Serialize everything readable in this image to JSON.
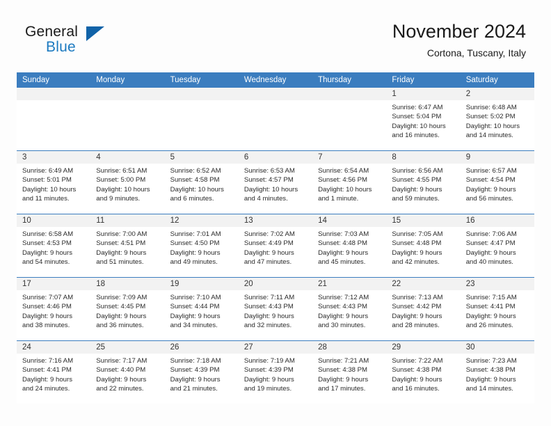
{
  "brand": {
    "name_part1": "General",
    "name_part2": "Blue",
    "logo_icon": "triangle-logo-icon"
  },
  "header": {
    "title": "November 2024",
    "location": "Cortona, Tuscany, Italy"
  },
  "colors": {
    "header_blue": "#3B7DBF",
    "brand_blue": "#1c7ac0",
    "logo_blue": "#1163a8",
    "daynum_band": "#f2f2f2",
    "page_bg": "#fdfdfd"
  },
  "weekdays": [
    "Sunday",
    "Monday",
    "Tuesday",
    "Wednesday",
    "Thursday",
    "Friday",
    "Saturday"
  ],
  "weeks": [
    [
      {
        "empty": true
      },
      {
        "empty": true
      },
      {
        "empty": true
      },
      {
        "empty": true
      },
      {
        "empty": true
      },
      {
        "day": "1",
        "sunrise": "Sunrise: 6:47 AM",
        "sunset": "Sunset: 5:04 PM",
        "daylight_line1": "Daylight: 10 hours",
        "daylight_line2": "and 16 minutes."
      },
      {
        "day": "2",
        "sunrise": "Sunrise: 6:48 AM",
        "sunset": "Sunset: 5:02 PM",
        "daylight_line1": "Daylight: 10 hours",
        "daylight_line2": "and 14 minutes."
      }
    ],
    [
      {
        "day": "3",
        "sunrise": "Sunrise: 6:49 AM",
        "sunset": "Sunset: 5:01 PM",
        "daylight_line1": "Daylight: 10 hours",
        "daylight_line2": "and 11 minutes."
      },
      {
        "day": "4",
        "sunrise": "Sunrise: 6:51 AM",
        "sunset": "Sunset: 5:00 PM",
        "daylight_line1": "Daylight: 10 hours",
        "daylight_line2": "and 9 minutes."
      },
      {
        "day": "5",
        "sunrise": "Sunrise: 6:52 AM",
        "sunset": "Sunset: 4:58 PM",
        "daylight_line1": "Daylight: 10 hours",
        "daylight_line2": "and 6 minutes."
      },
      {
        "day": "6",
        "sunrise": "Sunrise: 6:53 AM",
        "sunset": "Sunset: 4:57 PM",
        "daylight_line1": "Daylight: 10 hours",
        "daylight_line2": "and 4 minutes."
      },
      {
        "day": "7",
        "sunrise": "Sunrise: 6:54 AM",
        "sunset": "Sunset: 4:56 PM",
        "daylight_line1": "Daylight: 10 hours",
        "daylight_line2": "and 1 minute."
      },
      {
        "day": "8",
        "sunrise": "Sunrise: 6:56 AM",
        "sunset": "Sunset: 4:55 PM",
        "daylight_line1": "Daylight: 9 hours",
        "daylight_line2": "and 59 minutes."
      },
      {
        "day": "9",
        "sunrise": "Sunrise: 6:57 AM",
        "sunset": "Sunset: 4:54 PM",
        "daylight_line1": "Daylight: 9 hours",
        "daylight_line2": "and 56 minutes."
      }
    ],
    [
      {
        "day": "10",
        "sunrise": "Sunrise: 6:58 AM",
        "sunset": "Sunset: 4:53 PM",
        "daylight_line1": "Daylight: 9 hours",
        "daylight_line2": "and 54 minutes."
      },
      {
        "day": "11",
        "sunrise": "Sunrise: 7:00 AM",
        "sunset": "Sunset: 4:51 PM",
        "daylight_line1": "Daylight: 9 hours",
        "daylight_line2": "and 51 minutes."
      },
      {
        "day": "12",
        "sunrise": "Sunrise: 7:01 AM",
        "sunset": "Sunset: 4:50 PM",
        "daylight_line1": "Daylight: 9 hours",
        "daylight_line2": "and 49 minutes."
      },
      {
        "day": "13",
        "sunrise": "Sunrise: 7:02 AM",
        "sunset": "Sunset: 4:49 PM",
        "daylight_line1": "Daylight: 9 hours",
        "daylight_line2": "and 47 minutes."
      },
      {
        "day": "14",
        "sunrise": "Sunrise: 7:03 AM",
        "sunset": "Sunset: 4:48 PM",
        "daylight_line1": "Daylight: 9 hours",
        "daylight_line2": "and 45 minutes."
      },
      {
        "day": "15",
        "sunrise": "Sunrise: 7:05 AM",
        "sunset": "Sunset: 4:48 PM",
        "daylight_line1": "Daylight: 9 hours",
        "daylight_line2": "and 42 minutes."
      },
      {
        "day": "16",
        "sunrise": "Sunrise: 7:06 AM",
        "sunset": "Sunset: 4:47 PM",
        "daylight_line1": "Daylight: 9 hours",
        "daylight_line2": "and 40 minutes."
      }
    ],
    [
      {
        "day": "17",
        "sunrise": "Sunrise: 7:07 AM",
        "sunset": "Sunset: 4:46 PM",
        "daylight_line1": "Daylight: 9 hours",
        "daylight_line2": "and 38 minutes."
      },
      {
        "day": "18",
        "sunrise": "Sunrise: 7:09 AM",
        "sunset": "Sunset: 4:45 PM",
        "daylight_line1": "Daylight: 9 hours",
        "daylight_line2": "and 36 minutes."
      },
      {
        "day": "19",
        "sunrise": "Sunrise: 7:10 AM",
        "sunset": "Sunset: 4:44 PM",
        "daylight_line1": "Daylight: 9 hours",
        "daylight_line2": "and 34 minutes."
      },
      {
        "day": "20",
        "sunrise": "Sunrise: 7:11 AM",
        "sunset": "Sunset: 4:43 PM",
        "daylight_line1": "Daylight: 9 hours",
        "daylight_line2": "and 32 minutes."
      },
      {
        "day": "21",
        "sunrise": "Sunrise: 7:12 AM",
        "sunset": "Sunset: 4:43 PM",
        "daylight_line1": "Daylight: 9 hours",
        "daylight_line2": "and 30 minutes."
      },
      {
        "day": "22",
        "sunrise": "Sunrise: 7:13 AM",
        "sunset": "Sunset: 4:42 PM",
        "daylight_line1": "Daylight: 9 hours",
        "daylight_line2": "and 28 minutes."
      },
      {
        "day": "23",
        "sunrise": "Sunrise: 7:15 AM",
        "sunset": "Sunset: 4:41 PM",
        "daylight_line1": "Daylight: 9 hours",
        "daylight_line2": "and 26 minutes."
      }
    ],
    [
      {
        "day": "24",
        "sunrise": "Sunrise: 7:16 AM",
        "sunset": "Sunset: 4:41 PM",
        "daylight_line1": "Daylight: 9 hours",
        "daylight_line2": "and 24 minutes."
      },
      {
        "day": "25",
        "sunrise": "Sunrise: 7:17 AM",
        "sunset": "Sunset: 4:40 PM",
        "daylight_line1": "Daylight: 9 hours",
        "daylight_line2": "and 22 minutes."
      },
      {
        "day": "26",
        "sunrise": "Sunrise: 7:18 AM",
        "sunset": "Sunset: 4:39 PM",
        "daylight_line1": "Daylight: 9 hours",
        "daylight_line2": "and 21 minutes."
      },
      {
        "day": "27",
        "sunrise": "Sunrise: 7:19 AM",
        "sunset": "Sunset: 4:39 PM",
        "daylight_line1": "Daylight: 9 hours",
        "daylight_line2": "and 19 minutes."
      },
      {
        "day": "28",
        "sunrise": "Sunrise: 7:21 AM",
        "sunset": "Sunset: 4:38 PM",
        "daylight_line1": "Daylight: 9 hours",
        "daylight_line2": "and 17 minutes."
      },
      {
        "day": "29",
        "sunrise": "Sunrise: 7:22 AM",
        "sunset": "Sunset: 4:38 PM",
        "daylight_line1": "Daylight: 9 hours",
        "daylight_line2": "and 16 minutes."
      },
      {
        "day": "30",
        "sunrise": "Sunrise: 7:23 AM",
        "sunset": "Sunset: 4:38 PM",
        "daylight_line1": "Daylight: 9 hours",
        "daylight_line2": "and 14 minutes."
      }
    ]
  ]
}
